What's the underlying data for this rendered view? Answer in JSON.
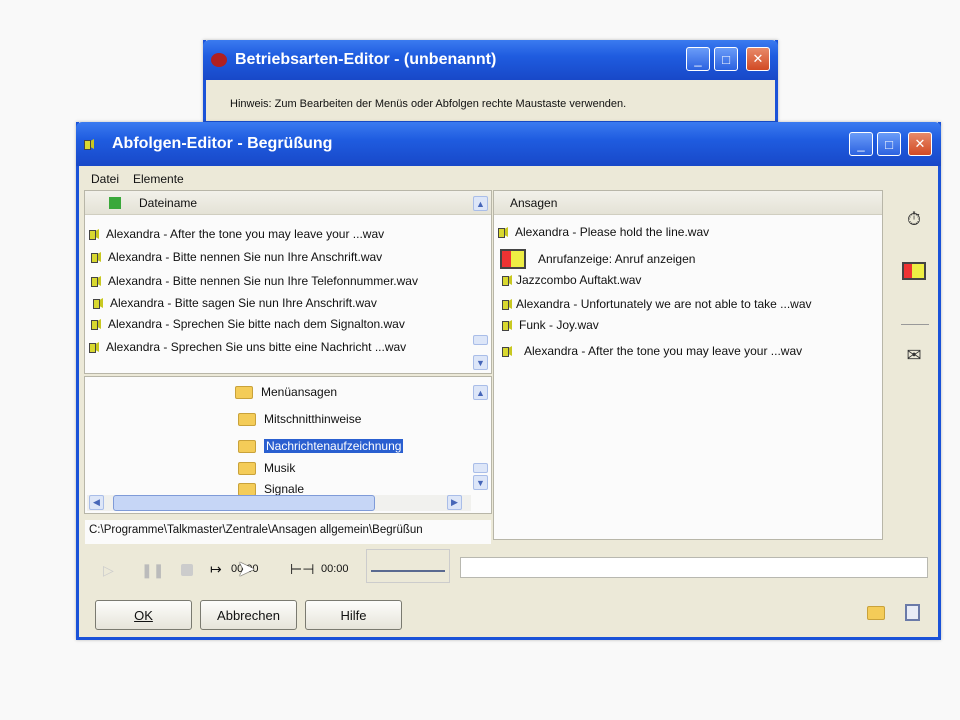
{
  "back_window": {
    "title": "Betriebsarten-Editor - (unbenannt)",
    "hint": "Hinweis: Zum Bearbeiten der Menüs oder Abfolgen rechte Maustaste verwenden."
  },
  "window": {
    "title": "Abfolgen-Editor - Begrüßung"
  },
  "menu": [
    "Datei",
    "Elemente"
  ],
  "files": {
    "header": "Dateiname",
    "items": [
      "Alexandra - After the tone you may leave your ...wav",
      "Alexandra - Bitte nennen Sie nun Ihre Anschrift.wav",
      "Alexandra - Bitte nennen Sie nun Ihre Telefonnummer.wav",
      "Alexandra - Bitte sagen Sie nun Ihre Anschrift.wav",
      "Alexandra - Sprechen Sie bitte nach dem Signalton.wav",
      "Alexandra - Sprechen Sie uns bitte eine Nachricht ...wav"
    ]
  },
  "folders": {
    "items": [
      "Menüansagen",
      "Mitschnitthinweise",
      "Nachrichtenaufzeichnung",
      "Musik",
      "Signale"
    ],
    "selected": "Nachrichtenaufzeichnung"
  },
  "path": "C:\\Programme\\Talkmaster\\Zentrale\\Ansagen allgemein\\Begrüßun",
  "ansagen": {
    "header": "Ansagen",
    "items": [
      {
        "type": "sound",
        "label": "Alexandra - Please hold the line.wav"
      },
      {
        "type": "display",
        "label": "Anrufanzeige: Anruf anzeigen"
      },
      {
        "type": "sound",
        "label": "Jazzcombo Auftakt.wav"
      },
      {
        "type": "sound",
        "label": "Alexandra - Unfortunately we are not able to take ...wav"
      },
      {
        "type": "sound",
        "label": "Funk - Joy.wav"
      },
      {
        "type": "sound",
        "label": "Alexandra - After the tone you may leave your ...wav"
      }
    ]
  },
  "player": {
    "position": "00:00",
    "length": "00:00"
  },
  "buttons": {
    "ok": "OK",
    "cancel": "Abbrechen",
    "help": "Hilfe"
  }
}
